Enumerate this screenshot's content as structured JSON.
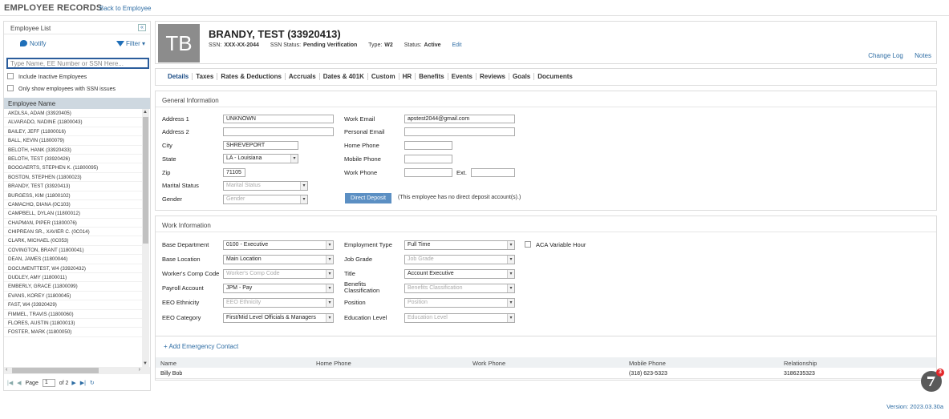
{
  "topbar": {
    "title": "EMPLOYEE RECORDS",
    "back_link": "Back to Employee"
  },
  "sidebar": {
    "header": "Employee List",
    "collapse": "«",
    "notify": "Notify",
    "filter": "Filter",
    "search_placeholder": "Type Name, EE Number or SSN Here...",
    "include_inactive": "Include Inactive Employees",
    "ssn_issues": "Only show employees with SSN issues",
    "column_header": "Employee Name",
    "employees": [
      "AKDLSA, ADAM (33920405)",
      "ALVARADO, NADINE (11800043)",
      "BAILEY, JEFF (11800016)",
      "BALL, KEVIN (11800079)",
      "BELOTH, HANK (33920433)",
      "BELOTH, TEST (33920426)",
      "BOOGAERTS, STEPHEN K. (11800095)",
      "BOSTON, STEPHEN (11800023)",
      "BRANDY, TEST (33920413)",
      "BURGESS, KIM (11800102)",
      "CAMACHO, DIANA (0C103)",
      "CAMPBELL, DYLAN (11800012)",
      "CHAPMAN, PIPER (11800076)",
      "CHIPREAN SR., XAVIER C. (0C014)",
      "CLARK, MICHAEL (0C053)",
      "COVINGTON, BRANT (11800041)",
      "DEAN, JAMES (11800044)",
      "DOCUMENTTEST, W4 (33920432)",
      "DUDLEY, AMY (11800011)",
      "EMBERLY, GRACE (11800099)",
      "EVANS, KOREY (11800045)",
      "FAST, W4 (33920429)",
      "FIMMEL, TRAVIS (11800060)",
      "FLORES, AUSTIN (11800013)",
      "FOSTER, MARK (11800050)"
    ],
    "pager": {
      "page_label": "Page",
      "page_value": "1",
      "of_label": "of 2"
    }
  },
  "employee": {
    "initials": "TB",
    "name": "BRANDY, TEST (33920413)",
    "ssn_label": "SSN:",
    "ssn_value": "XXX-XX-2044",
    "ssn_status_label": "SSN Status:",
    "ssn_status_value": "Pending Verification",
    "type_label": "Type:",
    "type_value": "W2",
    "status_label": "Status:",
    "status_value": "Active",
    "edit": "Edit",
    "change_log": "Change Log",
    "notes": "Notes"
  },
  "tabs": [
    "Details",
    "Taxes",
    "Rates & Deductions",
    "Accruals",
    "Dates & 401K",
    "Custom",
    "HR",
    "Benefits",
    "Events",
    "Reviews",
    "Goals",
    "Documents"
  ],
  "general": {
    "title": "General Information",
    "address1_label": "Address 1",
    "address1": "UNKNOWN",
    "address2_label": "Address 2",
    "address2": "",
    "city_label": "City",
    "city": "SHREVEPORT",
    "state_label": "State",
    "state": "LA - Louisiana",
    "zip_label": "Zip",
    "zip": "71105",
    "marital_label": "Marital Status",
    "marital_placeholder": "Marital Status",
    "gender_label": "Gender",
    "gender_placeholder": "Gender",
    "work_email_label": "Work Email",
    "work_email": "apstest2044@gmail.com",
    "personal_email_label": "Personal Email",
    "home_phone_label": "Home Phone",
    "mobile_phone_label": "Mobile Phone",
    "work_phone_label": "Work Phone",
    "ext_label": "Ext.",
    "direct_deposit_button": "Direct Deposit",
    "direct_deposit_note": "(This employee has no direct deposit account(s).)"
  },
  "work": {
    "title": "Work Information",
    "base_dept_label": "Base Department",
    "base_dept": "0100 - Executive",
    "base_loc_label": "Base Location",
    "base_loc": "Main Location",
    "wc_label": "Worker's Comp Code",
    "wc_placeholder": "Worker's Comp Code",
    "payroll_label": "Payroll Account",
    "payroll": "JPM - Pay",
    "eeo_eth_label": "EEO Ethnicity",
    "eeo_eth_placeholder": "EEO Ethnicity",
    "eeo_cat_label": "EEO Category",
    "eeo_cat": "First/Mid Level Officials & Managers",
    "emp_type_label": "Employment Type",
    "emp_type": "Full Time",
    "aca_label": "ACA Variable Hour",
    "job_grade_label": "Job Grade",
    "job_grade_placeholder": "Job Grade",
    "title_label": "Title",
    "title_value": "Account Executive",
    "benefits_label_1": "Benefits",
    "benefits_label_2": "Classification",
    "benefits_placeholder": "Benefits Classification",
    "position_label": "Position",
    "position_placeholder": "Position",
    "edu_label": "Education Level",
    "edu_placeholder": "Education Level"
  },
  "emergency": {
    "add": "+ Add Emergency Contact",
    "headers": {
      "name": "Name",
      "home": "Home Phone",
      "work": "Work Phone",
      "mobile": "Mobile Phone",
      "relationship": "Relationship"
    },
    "rows": [
      {
        "name": "Billy Bob",
        "home": "",
        "work": "",
        "mobile": "(318) 623-5323",
        "relationship": "3186235323"
      }
    ]
  },
  "footer": {
    "version": "Version: 2023.03.30a",
    "badge_count": "3"
  }
}
